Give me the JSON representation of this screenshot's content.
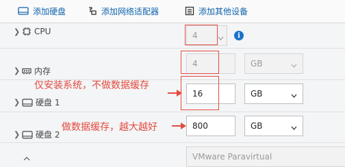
{
  "toolbar": {
    "add_disk": "添加硬盘",
    "add_network_adapter": "添加网络适配器",
    "add_other_device": "添加其他设备"
  },
  "rows": {
    "cpu": {
      "label": "CPU",
      "value": "4"
    },
    "memory": {
      "label": "内存",
      "value": "4",
      "unit": "GB"
    },
    "disk1": {
      "label": "硬盘 1",
      "value": "16",
      "unit": "GB"
    },
    "disk2": {
      "label": "硬盘 2",
      "value": "800",
      "unit": "GB"
    },
    "controller": {
      "value": "VMware Paravirtual"
    }
  },
  "annotations": {
    "disk1_note": "仅安装系统，不做数据缓存",
    "disk2_note": "做数据缓存，越大越好"
  },
  "colors": {
    "link_blue": "#0f64ad",
    "annotation_red": "#e34b3f",
    "info_blue": "#1a73c8"
  },
  "icons": {
    "info": "i"
  }
}
